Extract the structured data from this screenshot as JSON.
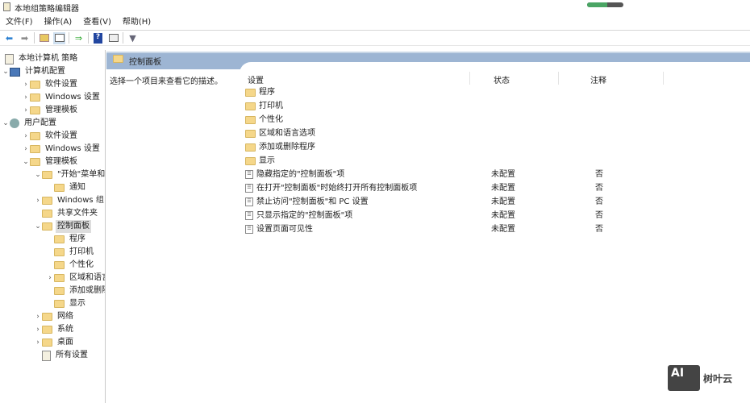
{
  "window": {
    "title": "本地组策略编辑器",
    "progress": 0.55
  },
  "menu": [
    "文件(F)",
    "操作(A)",
    "查看(V)",
    "帮助(H)"
  ],
  "toolbar": [
    "back-icon",
    "forward-icon",
    "up-folder-icon",
    "show-hide-tree-icon",
    "export-icon",
    "help-icon",
    "properties-icon",
    "filter-icon"
  ],
  "tree": [
    {
      "label": "本地计算机 策略",
      "level": 0,
      "chev": "",
      "icon": "doc"
    },
    {
      "label": "计算机配置",
      "level": 0,
      "chev": "v",
      "icon": "comp"
    },
    {
      "label": "软件设置",
      "level": 1,
      "chev": ">",
      "icon": "folder"
    },
    {
      "label": "Windows 设置",
      "level": 1,
      "chev": ">",
      "icon": "folder"
    },
    {
      "label": "管理模板",
      "level": 1,
      "chev": ">",
      "icon": "folder"
    },
    {
      "label": "用户配置",
      "level": 0,
      "chev": "v",
      "icon": "user"
    },
    {
      "label": "软件设置",
      "level": 1,
      "chev": ">",
      "icon": "folder"
    },
    {
      "label": "Windows 设置",
      "level": 1,
      "chev": ">",
      "icon": "folder"
    },
    {
      "label": "管理模板",
      "level": 1,
      "chev": "v",
      "icon": "folder"
    },
    {
      "label": "\"开始\"菜单和",
      "level": 2,
      "chev": "v",
      "icon": "folder"
    },
    {
      "label": "通知",
      "level": 3,
      "chev": "",
      "icon": "folder"
    },
    {
      "label": "Windows 组",
      "level": 2,
      "chev": ">",
      "icon": "folder"
    },
    {
      "label": "共享文件夹",
      "level": 2,
      "chev": "",
      "icon": "folder"
    },
    {
      "label": "控制面板",
      "level": 2,
      "chev": "v",
      "icon": "folder",
      "selected": true
    },
    {
      "label": "程序",
      "level": 3,
      "chev": "",
      "icon": "folder"
    },
    {
      "label": "打印机",
      "level": 3,
      "chev": "",
      "icon": "folder"
    },
    {
      "label": "个性化",
      "level": 3,
      "chev": "",
      "icon": "folder"
    },
    {
      "label": "区域和语言",
      "level": 3,
      "chev": ">",
      "icon": "folder"
    },
    {
      "label": "添加或删除",
      "level": 3,
      "chev": "",
      "icon": "folder"
    },
    {
      "label": "显示",
      "level": 3,
      "chev": "",
      "icon": "folder"
    },
    {
      "label": "网络",
      "level": 2,
      "chev": ">",
      "icon": "folder"
    },
    {
      "label": "系统",
      "level": 2,
      "chev": ">",
      "icon": "folder"
    },
    {
      "label": "桌面",
      "level": 2,
      "chev": ">",
      "icon": "folder"
    },
    {
      "label": "所有设置",
      "level": 2,
      "chev": "",
      "icon": "doc"
    }
  ],
  "main": {
    "header": "控制面板",
    "description": "选择一个项目来查看它的描述。",
    "columns": [
      "设置",
      "状态",
      "注释"
    ],
    "folders": [
      "程序",
      "打印机",
      "个性化",
      "区域和语言选项",
      "添加或删除程序",
      "显示"
    ],
    "settings": [
      {
        "name": "隐藏指定的\"控制面板\"项",
        "state": "未配置",
        "comment": "否"
      },
      {
        "name": "在打开\"控制面板\"时始终打开所有控制面板项",
        "state": "未配置",
        "comment": "否"
      },
      {
        "name": "禁止访问\"控制面板\"和 PC 设置",
        "state": "未配置",
        "comment": "否"
      },
      {
        "name": "只显示指定的\"控制面板\"项",
        "state": "未配置",
        "comment": "否"
      },
      {
        "name": "设置页面可见性",
        "state": "未配置",
        "comment": "否"
      }
    ]
  },
  "watermark": {
    "logo": "AI",
    "text": "树叶云"
  }
}
